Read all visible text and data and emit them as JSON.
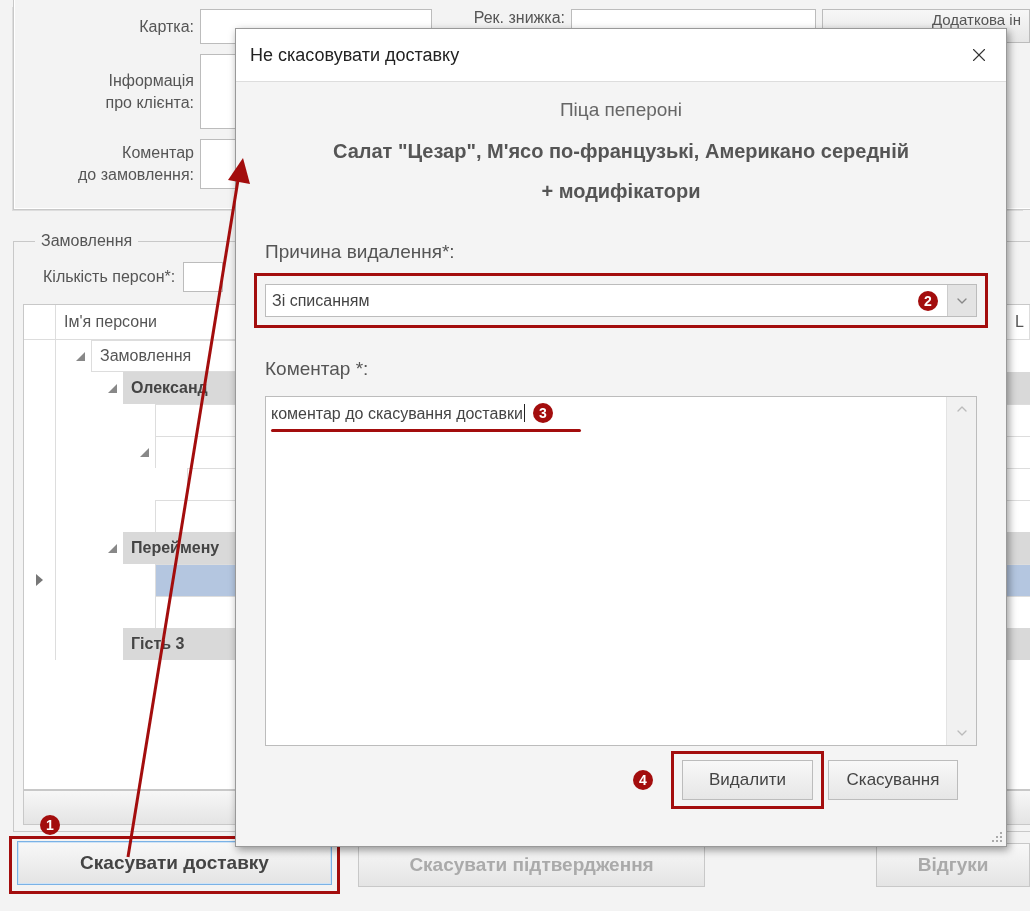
{
  "background": {
    "client_fields": [
      {
        "label": "Картка:"
      },
      {
        "label": "Інформація\nпро клієнта:"
      },
      {
        "label": "Коментар\nдо замовлення:"
      }
    ],
    "discount_label": "Рек. знижка:",
    "extra_info_button": "Додаткова ін",
    "order_group": {
      "title": "Замовлення",
      "persons_label": "Кількість персон*:",
      "grid": {
        "columns": [
          "Ім'я персони",
          "L"
        ],
        "rows": [
          {
            "kind": "root",
            "label": "Замовлення",
            "expanded": true,
            "selected": false,
            "children": [
              {
                "kind": "group",
                "label": "Олександ",
                "expanded": true,
                "selected": false,
                "children": [
                  {
                    "kind": "item",
                    "selected": false
                  },
                  {
                    "kind": "item",
                    "expanded": true,
                    "selected": false,
                    "children": [
                      {
                        "kind": "item",
                        "selected": false
                      }
                    ]
                  },
                  {
                    "kind": "item",
                    "selected": false
                  }
                ]
              },
              {
                "kind": "group",
                "label": "Переймену",
                "expanded": true,
                "selected": false,
                "children": [
                  {
                    "kind": "item",
                    "selected": true
                  },
                  {
                    "kind": "item",
                    "selected": false
                  }
                ]
              },
              {
                "kind": "group",
                "label": "Гість 3",
                "selected": false
              }
            ]
          }
        ]
      }
    },
    "bottom_buttons": [
      {
        "label": "Скасувати доставку",
        "disabled": false
      },
      {
        "label": "Скасувати підтвердження",
        "disabled": true
      },
      {
        "label": "Відгуки",
        "disabled": true
      }
    ]
  },
  "dialog": {
    "title": "Не скасовувати доставку",
    "item": "Піца пепероні",
    "items_bold": "Салат \"Цезар\", М'ясо по-французькі, Американо середній",
    "modifiers": "+ модифікатори",
    "reason_label": "Причина видалення*:",
    "reason_value": "Зі списанням",
    "comment_label": "Коментар *:",
    "comment_value": "коментар до скасування доставки",
    "buttons": [
      {
        "label": "Видалити"
      },
      {
        "label": "Скасування"
      }
    ]
  },
  "annotations": [
    "1",
    "2",
    "3",
    "4"
  ]
}
